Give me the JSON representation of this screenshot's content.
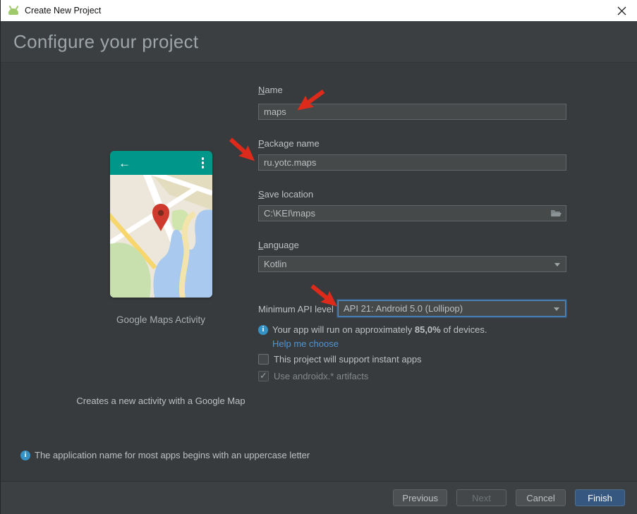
{
  "window": {
    "title": "Create New Project"
  },
  "header": {
    "title": "Configure your project"
  },
  "preview": {
    "caption": "Google Maps Activity",
    "description": "Creates a new activity with a Google Map"
  },
  "form": {
    "name": {
      "label": "Name",
      "value": "maps"
    },
    "package": {
      "label": "Package name",
      "value": "ru.yotc.maps"
    },
    "save_location": {
      "label": "Save location",
      "value": "C:\\KEI\\maps"
    },
    "language": {
      "label": "Language",
      "value": "Kotlin"
    },
    "min_api": {
      "label": "Minimum API level",
      "value": "API 21: Android 5.0 (Lollipop)"
    },
    "api_info": {
      "prefix": "Your app will run on approximately ",
      "highlight": "85,0%",
      "suffix": " of devices."
    },
    "help_link": "Help me choose",
    "instant_apps": {
      "label": "This project will support instant apps",
      "checked": false
    },
    "androidx": {
      "label": "Use androidx.* artifacts",
      "checked": true,
      "disabled": true
    }
  },
  "status_bar": {
    "message": "The application name for most apps begins with an uppercase letter"
  },
  "footer": {
    "previous": "Previous",
    "next": "Next",
    "cancel": "Cancel",
    "finish": "Finish"
  },
  "icons": {
    "android_logo": "android-head",
    "close": "x",
    "info": "i",
    "folder": "open-folder",
    "back_arrow": "left-arrow",
    "overflow": "vertical-dots"
  },
  "colors": {
    "titlebar_bg": "#ffffff",
    "dialog_bg": "#383b3d",
    "field_bg": "#45494a",
    "field_border": "#616668",
    "focus_blue": "#4e8cc8",
    "link_blue": "#4f94d4",
    "info_icon_blue": "#3592c4",
    "annotation_red": "#dd2a1b",
    "toolbar_teal": "#00968a",
    "marker_red": "#ce3a2d",
    "map_water": "#a9c9ef",
    "map_green": "#c8e0ad",
    "map_yellow_road": "#f6d66d",
    "finish_button_bg": "#365880"
  }
}
